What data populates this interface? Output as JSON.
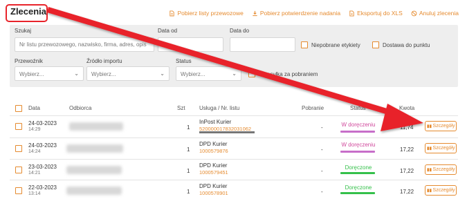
{
  "header": {
    "title": "Zlecenia",
    "actions": [
      {
        "label": "Pobierz listy przewozowe",
        "icon": "document-icon"
      },
      {
        "label": "Pobierz potwierdzenie nadania",
        "icon": "download-icon"
      },
      {
        "label": "Eksportuj do XLS",
        "icon": "file-icon"
      },
      {
        "label": "Anuluj zlecenia",
        "icon": "cancel-icon"
      }
    ]
  },
  "filters": {
    "search_label": "Szukaj",
    "search_placeholder": "Nr listu przewozowego, nazwisko, firma, adres, opis",
    "date_from_label": "Data od",
    "date_to_label": "Data do",
    "unpicked_labels": "Niepobrane etykiety",
    "delivery_to_point": "Dostawa do punktu",
    "carrier_label": "Przewoźnik",
    "carrier_value": "Wybierz...",
    "source_label": "Źródło importu",
    "source_value": "Wybierz...",
    "status_label": "Status",
    "status_value": "Wybierz...",
    "cod_label": "Przesyłka za pobraniem"
  },
  "table": {
    "headers": {
      "date": "Data",
      "recipient": "Odbiorca",
      "qty": "Szt",
      "service": "Usługa / Nr. listu",
      "cod": "Pobranie",
      "status": "Status",
      "amount": "Kwota"
    },
    "rows": [
      {
        "date": "24-03-2023",
        "time": "14:29",
        "qty": "1",
        "courier": "InPost Kurier",
        "tracking": "520000017832031062",
        "cod": "-",
        "status": "W doręczeniu",
        "status_color": "#d0489c",
        "amount": "11,74",
        "details": "Szczegóły"
      },
      {
        "date": "24-03-2023",
        "time": "14:24",
        "qty": "1",
        "courier": "DPD Kurier",
        "tracking": "1000579876",
        "cod": "-",
        "status": "W doręczeniu",
        "status_color": "#d0489c",
        "amount": "17,22",
        "details": "Szczegóły"
      },
      {
        "date": "23-03-2023",
        "time": "14:21",
        "qty": "1",
        "courier": "DPD Kurier",
        "tracking": "1000579451",
        "cod": "-",
        "status": "Doręczone",
        "status_color": "#34c04a",
        "amount": "17,22",
        "details": "Szczegóły"
      },
      {
        "date": "22-03-2023",
        "time": "13:14",
        "qty": "1",
        "courier": "DPD Kurier",
        "tracking": "1000578901",
        "cod": "-",
        "status": "Doręczone",
        "status_color": "#34c04a",
        "amount": "17,22",
        "details": "Szczegóły"
      }
    ]
  },
  "colors": {
    "accent": "#e58a2e",
    "annotation": "#e8232a"
  }
}
